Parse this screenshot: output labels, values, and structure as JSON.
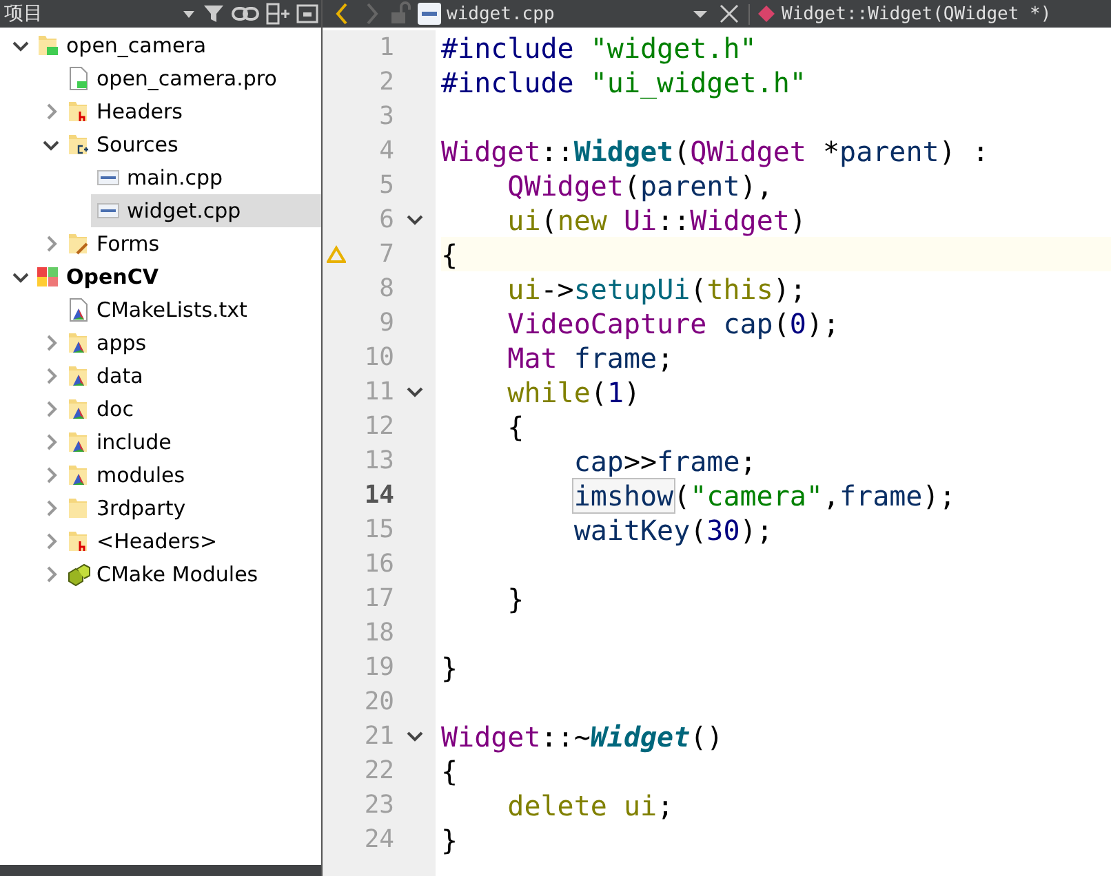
{
  "sidebar": {
    "title": "项目",
    "tree": [
      {
        "label": "open_camera",
        "kind": "qtfolder",
        "bold": false,
        "expanded": true,
        "selected": false,
        "children": [
          {
            "label": "open_camera.pro",
            "kind": "qtfile",
            "selected": false
          },
          {
            "label": "Headers",
            "kind": "hfolder",
            "expanded": false,
            "selected": false
          },
          {
            "label": "Sources",
            "kind": "cppfolder",
            "expanded": true,
            "selected": false,
            "children": [
              {
                "label": "main.cpp",
                "kind": "cppfile",
                "selected": false
              },
              {
                "label": "widget.cpp",
                "kind": "cppfile",
                "selected": true
              }
            ]
          },
          {
            "label": "Forms",
            "kind": "formfolder",
            "expanded": false,
            "selected": false
          }
        ]
      },
      {
        "label": "OpenCV",
        "kind": "cmakeproject",
        "bold": true,
        "expanded": true,
        "selected": false,
        "children": [
          {
            "label": "CMakeLists.txt",
            "kind": "cmakefile",
            "selected": false
          },
          {
            "label": "apps",
            "kind": "cmakefolder",
            "expanded": false,
            "selected": false
          },
          {
            "label": "data",
            "kind": "cmakefolder",
            "expanded": false,
            "selected": false
          },
          {
            "label": "doc",
            "kind": "cmakefolder",
            "expanded": false,
            "selected": false
          },
          {
            "label": "include",
            "kind": "cmakefolder",
            "expanded": false,
            "selected": false
          },
          {
            "label": "modules",
            "kind": "cmakefolder",
            "expanded": false,
            "selected": false
          },
          {
            "label": "3rdparty",
            "kind": "folder",
            "expanded": false,
            "selected": false
          },
          {
            "label": "<Headers>",
            "kind": "hfolder",
            "expanded": false,
            "selected": false
          },
          {
            "label": "CMake Modules",
            "kind": "cubes",
            "expanded": false,
            "selected": false
          }
        ]
      }
    ]
  },
  "editor": {
    "file": "widget.cpp",
    "symbol": "Widget::Widget(QWidget *)",
    "lines": [
      {
        "number": "1",
        "current": false,
        "warning": false,
        "fold": false,
        "tokens": [
          {
            "t": "#include",
            "kind": "pre"
          },
          {
            "t": " \"widget.h\"",
            "kind": "str"
          }
        ]
      },
      {
        "number": "2",
        "current": false,
        "warning": false,
        "fold": false,
        "tokens": [
          {
            "t": "#include",
            "kind": "pre"
          },
          {
            "t": " \"ui_widget.h\"",
            "kind": "str"
          }
        ]
      },
      {
        "number": "3",
        "current": false,
        "warning": false,
        "fold": false
      },
      {
        "number": "4",
        "current": false,
        "warning": false,
        "fold": false,
        "tokens": [
          {
            "t": "Widget",
            "kind": "cls"
          },
          {
            "t": "::",
            "kind": "plain"
          },
          {
            "t": "Widget",
            "kind": "def"
          },
          {
            "t": "(",
            "kind": "plain"
          },
          {
            "t": "QWidget",
            "kind": "cls"
          },
          {
            "t": " *",
            "kind": "plain"
          },
          {
            "t": "parent",
            "kind": "var"
          },
          {
            "t": ") :",
            "kind": "plain"
          }
        ]
      },
      {
        "number": "5",
        "current": false,
        "warning": false,
        "fold": false,
        "tokens": [
          {
            "t": "    QWidget",
            "kind": "cls"
          },
          {
            "t": "(",
            "kind": "plain"
          },
          {
            "t": "parent",
            "kind": "var"
          },
          {
            "t": "),",
            "kind": "plain"
          }
        ]
      },
      {
        "number": "6",
        "current": false,
        "warning": false,
        "fold": true,
        "tokens": [
          {
            "t": "    ui",
            "kind": "kw"
          },
          {
            "t": "(",
            "kind": "plain"
          },
          {
            "t": "new",
            "kind": "kw"
          },
          {
            "t": " Ui",
            "kind": "cls"
          },
          {
            "t": "::",
            "kind": "plain"
          },
          {
            "t": "Widget",
            "kind": "cls"
          },
          {
            "t": ")",
            "kind": "plain"
          }
        ]
      },
      {
        "number": "7",
        "current": false,
        "warning": true,
        "fold": false,
        "tokens": [
          {
            "t": "{",
            "kind": "plain"
          }
        ]
      },
      {
        "number": "8",
        "current": false,
        "warning": false,
        "fold": false,
        "tokens": [
          {
            "t": "    ui",
            "kind": "kw"
          },
          {
            "t": "->",
            "kind": "plain"
          },
          {
            "t": "setupUi",
            "kind": "fn"
          },
          {
            "t": "(",
            "kind": "plain"
          },
          {
            "t": "this",
            "kind": "kw"
          },
          {
            "t": ");",
            "kind": "plain"
          }
        ]
      },
      {
        "number": "9",
        "current": false,
        "warning": false,
        "fold": false,
        "tokens": [
          {
            "t": "    VideoCapture",
            "kind": "cls"
          },
          {
            "t": " cap",
            "kind": "var"
          },
          {
            "t": "(",
            "kind": "plain"
          },
          {
            "t": "0",
            "kind": "num"
          },
          {
            "t": ");",
            "kind": "plain"
          }
        ]
      },
      {
        "number": "10",
        "current": false,
        "warning": false,
        "fold": false,
        "tokens": [
          {
            "t": "    Mat",
            "kind": "cls"
          },
          {
            "t": " frame",
            "kind": "var"
          },
          {
            "t": ";",
            "kind": "plain"
          }
        ]
      },
      {
        "number": "11",
        "current": false,
        "warning": false,
        "fold": true,
        "tokens": [
          {
            "t": "    while",
            "kind": "kw"
          },
          {
            "t": "(",
            "kind": "plain"
          },
          {
            "t": "1",
            "kind": "num"
          },
          {
            "t": ")",
            "kind": "plain"
          }
        ]
      },
      {
        "number": "12",
        "current": false,
        "warning": false,
        "fold": false,
        "tokens": [
          {
            "t": "    {",
            "kind": "plain"
          }
        ]
      },
      {
        "number": "13",
        "current": false,
        "warning": false,
        "fold": false,
        "tokens": [
          {
            "t": "        cap",
            "kind": "var"
          },
          {
            "t": ">>",
            "kind": "plain"
          },
          {
            "t": "frame",
            "kind": "var"
          },
          {
            "t": ";",
            "kind": "plain"
          }
        ]
      },
      {
        "number": "14",
        "current": true,
        "warning": false,
        "fold": false,
        "tokens": [
          {
            "t": "        imshow",
            "kind": "boxed"
          },
          {
            "t": "(",
            "kind": "plain"
          },
          {
            "t": "\"camera\"",
            "kind": "str"
          },
          {
            "t": ",",
            "kind": "plain"
          },
          {
            "t": "frame",
            "kind": "var"
          },
          {
            "t": ");",
            "kind": "plain"
          }
        ]
      },
      {
        "number": "15",
        "current": false,
        "warning": false,
        "fold": false,
        "tokens": [
          {
            "t": "        waitKey",
            "kind": "var"
          },
          {
            "t": "(",
            "kind": "plain"
          },
          {
            "t": "30",
            "kind": "num"
          },
          {
            "t": ");",
            "kind": "plain"
          }
        ]
      },
      {
        "number": "16",
        "current": false,
        "warning": false,
        "fold": false
      },
      {
        "number": "17",
        "current": false,
        "warning": false,
        "fold": false,
        "tokens": [
          {
            "t": "    }",
            "kind": "plain"
          }
        ]
      },
      {
        "number": "18",
        "current": false,
        "warning": false,
        "fold": false
      },
      {
        "number": "19",
        "current": false,
        "warning": false,
        "fold": false,
        "tokens": [
          {
            "t": "}",
            "kind": "plain"
          }
        ]
      },
      {
        "number": "20",
        "current": false,
        "warning": false,
        "fold": false
      },
      {
        "number": "21",
        "current": false,
        "warning": false,
        "fold": true,
        "tokens": [
          {
            "t": "Widget",
            "kind": "cls"
          },
          {
            "t": "::~",
            "kind": "plain"
          },
          {
            "t": "Widget",
            "kind": "dtor"
          },
          {
            "t": "()",
            "kind": "plain"
          }
        ]
      },
      {
        "number": "22",
        "current": false,
        "warning": false,
        "fold": false,
        "tokens": [
          {
            "t": "{",
            "kind": "plain"
          }
        ]
      },
      {
        "number": "23",
        "current": false,
        "warning": false,
        "fold": false,
        "tokens": [
          {
            "t": "    delete",
            "kind": "kw"
          },
          {
            "t": " ui",
            "kind": "kw"
          },
          {
            "t": ";",
            "kind": "plain"
          }
        ]
      },
      {
        "number": "24",
        "current": false,
        "warning": false,
        "fold": false,
        "tokens": [
          {
            "t": "}",
            "kind": "plain"
          }
        ]
      }
    ]
  }
}
